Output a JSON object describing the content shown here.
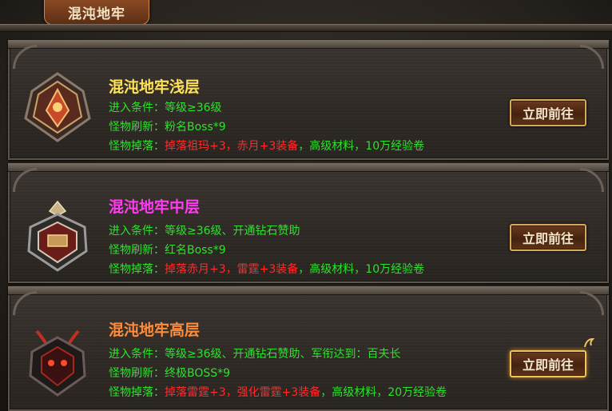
{
  "window": {
    "title": "混沌地牢"
  },
  "floors": [
    {
      "title": "混沌地牢浅层",
      "title_color": "#ffe25a",
      "req_label": "进入条件：",
      "req_value": "等级≥36级",
      "refresh_label": "怪物刷新：",
      "refresh_value": "粉名Boss*9",
      "drop_label": "怪物掉落：",
      "drop_red": "掉落祖玛+3，赤月+3装备",
      "drop_green": "，高级材料，10万经验卷",
      "button": "立即前往",
      "emblem": "bronze-wing-crest-icon"
    },
    {
      "title": "混沌地牢中层",
      "title_color": "#ff3cf0",
      "req_label": "进入条件：",
      "req_value": "等级≥36级、开通钻石赞助",
      "refresh_label": "怪物刷新：",
      "refresh_value": "红名Boss*9",
      "drop_label": "怪物掉落：",
      "drop_red": "掉落赤月+3，雷霆+3装备",
      "drop_green": "，高级材料，10万经验卷",
      "button": "立即前往",
      "emblem": "silver-crown-crest-icon"
    },
    {
      "title": "混沌地牢高层",
      "title_color": "#ff8c3a",
      "req_label": "进入条件：",
      "req_value": "等级≥36级、开通钻石赞助、军衔达到：百夫长",
      "refresh_label": "怪物刷新：",
      "refresh_value": "终极BOSS*9",
      "drop_label": "怪物掉落：",
      "drop_red": "掉落雷霆+3，强化雷霆+3装备",
      "drop_green": "，高级材料，20万经验卷",
      "button": "立即前往",
      "emblem": "dark-demon-crest-icon"
    }
  ],
  "colors": {
    "accent_green": "#2fe02f",
    "drop_red": "#ff2a2a",
    "button_border": "#d8a85a"
  }
}
